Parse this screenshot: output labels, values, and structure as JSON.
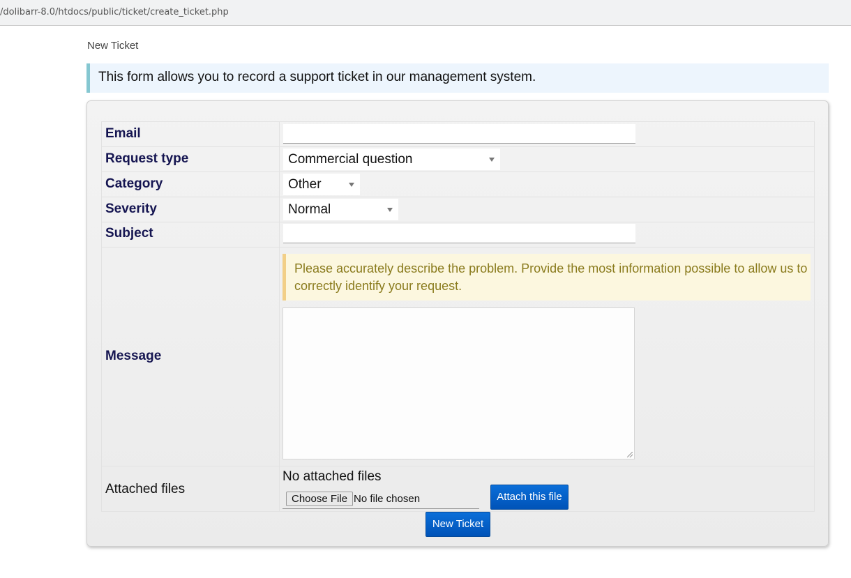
{
  "browser": {
    "url": "/dolibarr-8.0/htdocs/public/ticket/create_ticket.php"
  },
  "page": {
    "breadcrumb": "New Ticket",
    "info_text": "This form allows you to record a support ticket in our management system."
  },
  "form": {
    "email": {
      "label": "Email",
      "value": ""
    },
    "request_type": {
      "label": "Request type",
      "selected": "Commercial question"
    },
    "category": {
      "label": "Category",
      "selected": "Other"
    },
    "severity": {
      "label": "Severity",
      "selected": "Normal"
    },
    "subject": {
      "label": "Subject",
      "value": ""
    },
    "message": {
      "label": "Message",
      "hint": "Please accurately describe the problem. Provide the most information possible to allow us to correctly identify your request.",
      "value": ""
    },
    "attachments": {
      "label": "Attached files",
      "status": "No attached files",
      "choose_button": "Choose File",
      "no_file_text": "No file chosen",
      "attach_button": "Attach this file"
    },
    "submit_button": "New Ticket"
  }
}
